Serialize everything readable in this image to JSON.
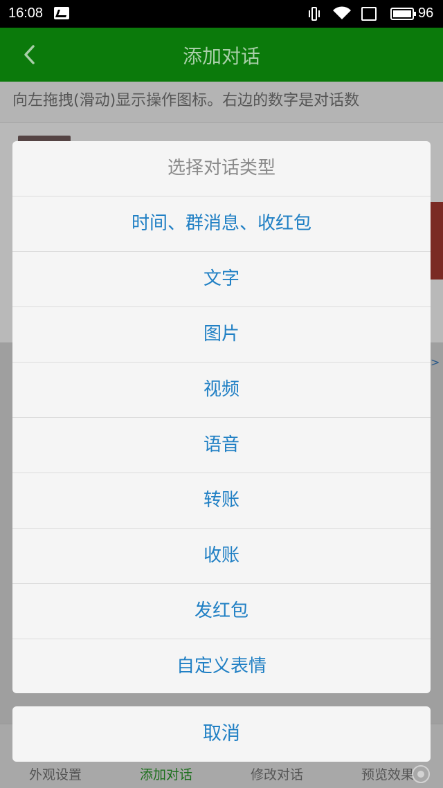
{
  "status_bar": {
    "time": "16:08",
    "battery": "96"
  },
  "header": {
    "title": "添加对话"
  },
  "hint": "向左拖拽(滑动)显示操作图标。右边的数字是对话数",
  "dialog": {
    "title": "选择对话类型",
    "options": [
      "时间、群消息、收红包",
      "文字",
      "图片",
      "视频",
      "语音",
      "转账",
      "收账",
      "发红包",
      "自定义表情"
    ]
  },
  "cancel_label": "取消",
  "bottom_nav": {
    "tabs": [
      "外观设置",
      "添加对话",
      "修改对话",
      "预览效果"
    ],
    "active": "添加对话"
  },
  "colors": {
    "title_bar": "#0b7a0b",
    "option_text": "#1f7fc4",
    "dialog_bg": "#f5f5f5"
  },
  "icons": [
    "image-icon",
    "vibrate-icon",
    "wifi-icon",
    "screen-icon",
    "battery-icon",
    "back-chevron-icon"
  ]
}
